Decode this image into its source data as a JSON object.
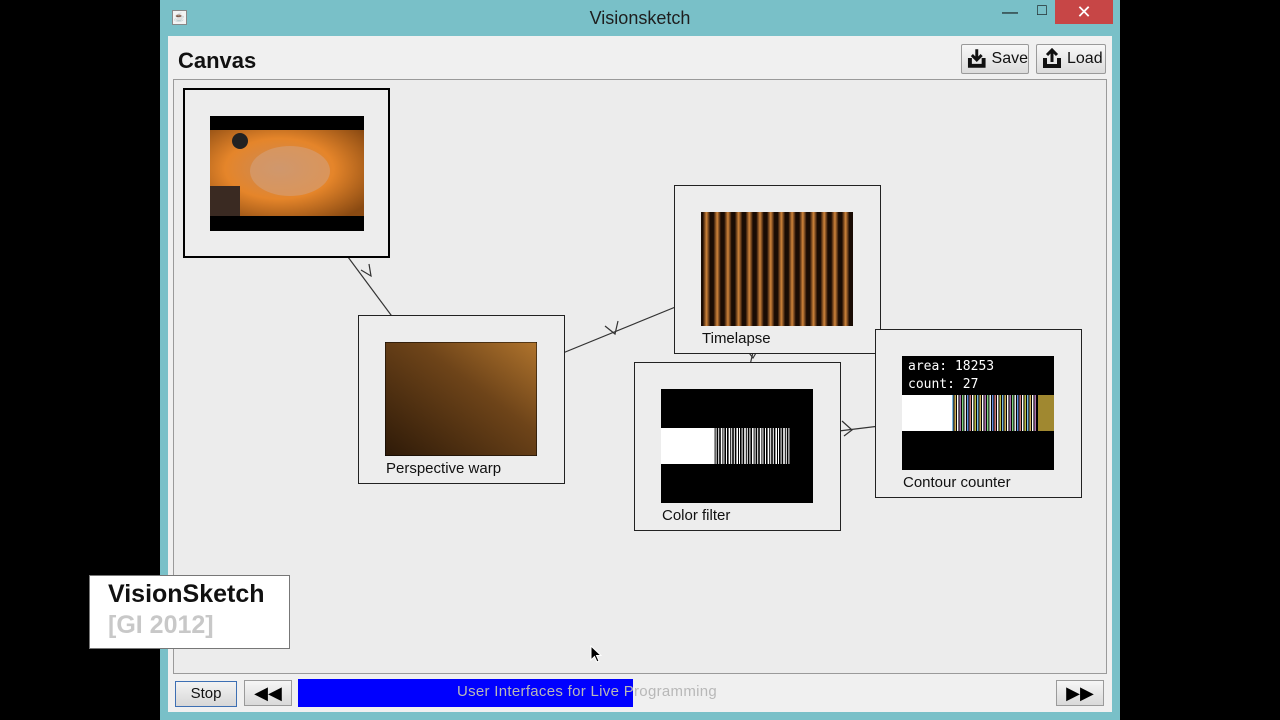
{
  "window": {
    "title": "Visionsketch",
    "minimize_glyph": "—",
    "maximize_glyph": "□",
    "close_glyph": "✕",
    "app_icon": "java-icon"
  },
  "header": {
    "title": "Canvas",
    "save_label": "Save",
    "load_label": "Load",
    "save_icon": "save-icon",
    "load_icon": "load-icon"
  },
  "nodes": [
    {
      "id": "camera",
      "label": ""
    },
    {
      "id": "perspective",
      "label": "Perspective warp"
    },
    {
      "id": "timelapse",
      "label": "Timelapse"
    },
    {
      "id": "color",
      "label": "Color filter"
    },
    {
      "id": "contour",
      "label": "Contour counter",
      "area_text": "area: 18253",
      "count_text": "count: 27"
    }
  ],
  "playback": {
    "stop_label": "Stop",
    "rewind_glyph": "◀◀",
    "forward_glyph": "▶▶",
    "progress": 0.58,
    "progress_color": "#0000ff",
    "overlay_text": "User Interfaces for Live Programming"
  },
  "caption": {
    "title": "VisionSketch",
    "subtitle": "[GI 2012]"
  }
}
